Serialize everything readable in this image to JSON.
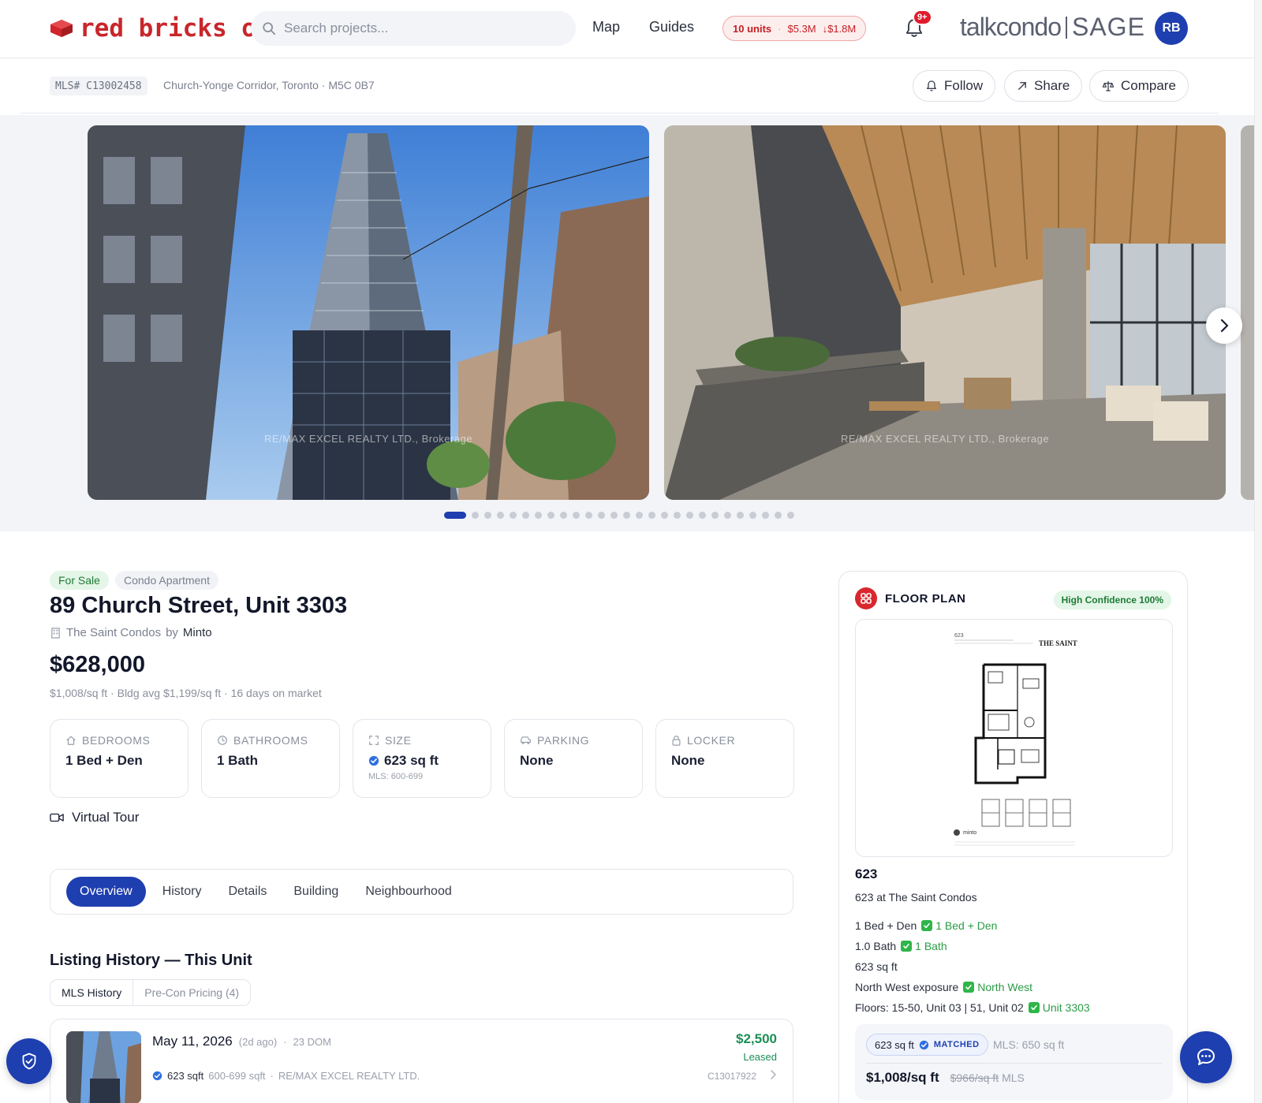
{
  "brand": {
    "logo_text": "red bricks os",
    "logo_color": "#c8262b",
    "partner": "talkcondo",
    "partner_product": "SAGE"
  },
  "search": {
    "placeholder": "Search projects..."
  },
  "nav": {
    "map": "Map",
    "guides": "Guides"
  },
  "market": {
    "units": "10 units",
    "value": "$5.3M",
    "change": "↓$1.8M"
  },
  "notifications": {
    "badge": "9+"
  },
  "user": {
    "initials": "RB"
  },
  "listing_header": {
    "mls": "MLS# C13002458",
    "location": "Church-Yonge Corridor, Toronto · M5C 0B7",
    "actions": {
      "follow": "Follow",
      "share": "Share",
      "compare": "Compare"
    }
  },
  "gallery": {
    "watermark": "RE/MAX EXCEL REALTY LTD., Brokerage",
    "photos": [
      "building-exterior",
      "lobby-interior"
    ],
    "dot_count": 27,
    "active_index": 0
  },
  "listing": {
    "status": "For Sale",
    "type": "Condo Apartment",
    "title": "89 Church Street, Unit 3303",
    "project": "The Saint Condos",
    "by": "by",
    "developer": "Minto",
    "price": "$628,000",
    "price_sub": "$1,008/sq ft  · Bldg avg $1,199/sq ft · 16 days on market",
    "specs": [
      {
        "label": "BEDROOMS",
        "value": "1 Bed + Den",
        "icon": "home-icon"
      },
      {
        "label": "BATHROOMS",
        "value": "1 Bath",
        "icon": "bath-icon"
      },
      {
        "label": "SIZE",
        "value": "623 sq ft",
        "note": "MLS: 600-699",
        "icon": "expand-icon"
      },
      {
        "label": "PARKING",
        "value": "None",
        "icon": "car-icon"
      },
      {
        "label": "LOCKER",
        "value": "None",
        "icon": "lock-icon"
      }
    ],
    "virtual_tour": "Virtual Tour"
  },
  "tabs": [
    "Overview",
    "History",
    "Details",
    "Building",
    "Neighbourhood"
  ],
  "history": {
    "title": "Listing History — This Unit",
    "subtabs": [
      "MLS History",
      "Pre-Con Pricing (4)"
    ],
    "entries": [
      {
        "date": "May 11, 2026",
        "ago": "(2d ago)",
        "dom": "23 DOM",
        "sqft": "623 sqft",
        "range": "600-699 sqft",
        "brokerage": "RE/MAX EXCEL REALTY LTD.",
        "price": "$2,500",
        "status": "Leased",
        "mls": "C13017922"
      }
    ]
  },
  "floor_plan": {
    "title": "FLOOR PLAN",
    "confidence": "High Confidence 100%",
    "plan_brand": "THE SAINT",
    "plan_code": "623",
    "plan_logo": "minto",
    "name": "623",
    "subtitle": "623 at The Saint Condos",
    "rows": [
      {
        "text": "1 Bed + Den",
        "match": "1 Bed + Den"
      },
      {
        "text": "1.0 Bath",
        "match": "1 Bath"
      },
      {
        "text": "623 sq ft",
        "match": ""
      },
      {
        "text": "North West exposure",
        "match": "North West"
      },
      {
        "text": "Floors: 15-50, Unit 03 | 51, Unit 02",
        "match": "Unit 3303"
      }
    ],
    "match_sqft": "623 sq ft",
    "match_label": "MATCHED",
    "mls_sqft": "MLS: 650 sq ft",
    "ppsf": "$1,008/sq ft",
    "ppsf_old": "$966/sq ft",
    "ppsf_label": "MLS"
  },
  "colors": {
    "primary": "#1e3fb0",
    "brand_red": "#c8262b",
    "success": "#1f7a35"
  }
}
